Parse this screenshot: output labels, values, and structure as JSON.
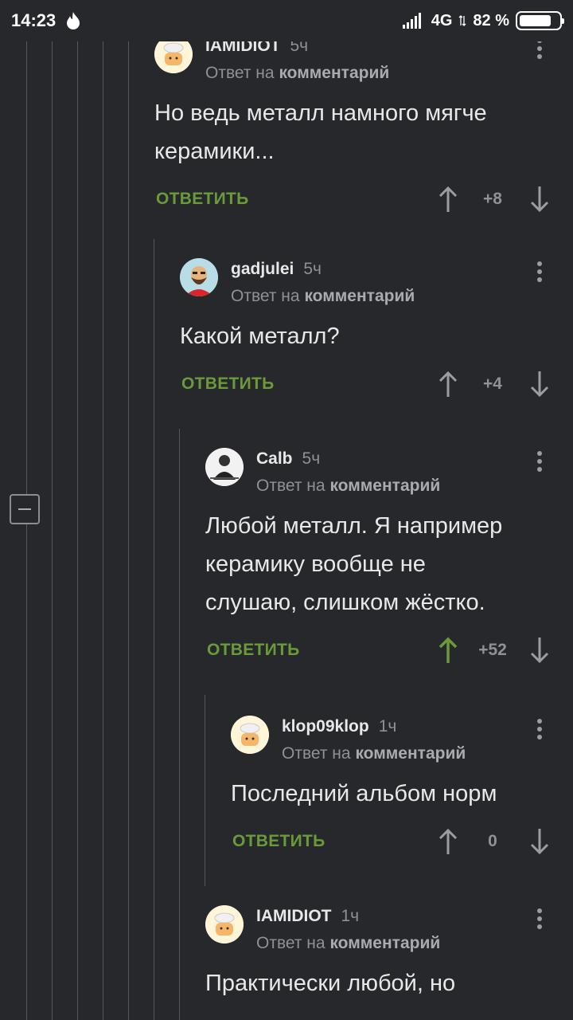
{
  "status": {
    "time": "14:23",
    "network": "4G",
    "battery": "82 %",
    "battery_level": 0.82
  },
  "comments": [
    {
      "user": "IAMIDIOT",
      "time": "5ч",
      "reply_prefix": "Ответ на",
      "reply_link": "комментарий",
      "lines": [
        "Но ведь металл намного мягче",
        "керамики..."
      ],
      "reply_label": "ОТВЕТИТЬ",
      "score": "+8",
      "upvoted": false
    },
    {
      "user": "gadjulei",
      "time": "5ч",
      "reply_prefix": "Ответ на",
      "reply_link": "комментарий",
      "lines": [
        "Какой металл?"
      ],
      "reply_label": "ОТВЕТИТЬ",
      "score": "+4",
      "upvoted": false
    },
    {
      "user": "Calb",
      "time": "5ч",
      "reply_prefix": "Ответ на",
      "reply_link": "комментарий",
      "lines": [
        "Любой металл. Я например",
        "керамику вообще не",
        "слушаю, слишком жёстко."
      ],
      "reply_label": "ОТВЕТИТЬ",
      "score": "+52",
      "upvoted": true
    },
    {
      "user": "klop09klop",
      "time": "1ч",
      "reply_prefix": "Ответ на",
      "reply_link": "комментарий",
      "lines": [
        "Последний альбом норм"
      ],
      "reply_label": "ОТВЕТИТЬ",
      "score": "0",
      "upvoted": false
    },
    {
      "user": "IAMIDIOT",
      "time": "1ч",
      "reply_prefix": "Ответ на",
      "reply_link": "комментарий",
      "lines": [
        "Практически любой, но"
      ],
      "reply_label": "",
      "score": "",
      "upvoted": false
    }
  ],
  "colors": {
    "background": "#26282b",
    "accent_green": "#6a9a3a",
    "muted": "#8e9196"
  }
}
